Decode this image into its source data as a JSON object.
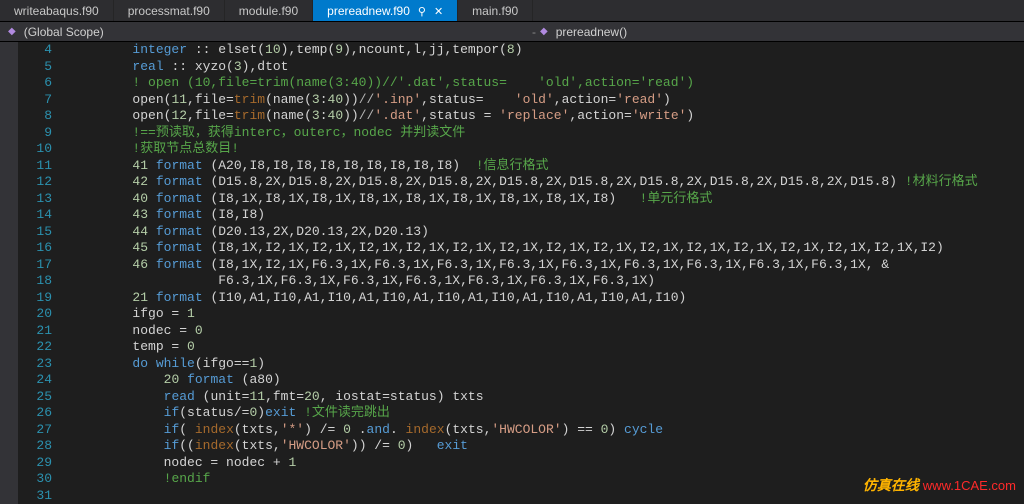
{
  "tabs": [
    {
      "label": "writeabaqus.f90",
      "active": false
    },
    {
      "label": "processmat.f90",
      "active": false
    },
    {
      "label": "module.f90",
      "active": false
    },
    {
      "label": "prereadnew.f90",
      "active": true
    },
    {
      "label": "main.f90",
      "active": false
    }
  ],
  "breadcrumb": {
    "scope": "(Global Scope)",
    "member": "prereadnew()"
  },
  "line_start": 4,
  "code": [
    [
      [
        "kw",
        "integer"
      ],
      [
        "txt",
        " :: elset("
      ],
      [
        "num",
        "10"
      ],
      [
        "txt",
        "),temp("
      ],
      [
        "num",
        "9"
      ],
      [
        "txt",
        "),ncount,l,jj,tempor("
      ],
      [
        "num",
        "8"
      ],
      [
        "txt",
        ")"
      ]
    ],
    [
      [
        "kw",
        "real"
      ],
      [
        "txt",
        " :: xyzo("
      ],
      [
        "num",
        "3"
      ],
      [
        "txt",
        "),dtot"
      ]
    ],
    [
      [
        "cmt",
        "! open (10,file=trim(name(3:40))//'.dat',status=    'old',action='read')"
      ]
    ],
    [
      [
        "txt",
        "open("
      ],
      [
        "num",
        "11"
      ],
      [
        "txt",
        ",file="
      ],
      [
        "fn",
        "trim"
      ],
      [
        "txt",
        "(name("
      ],
      [
        "num",
        "3"
      ],
      [
        "txt",
        ":"
      ],
      [
        "num",
        "40"
      ],
      [
        "txt",
        "))"
      ],
      [
        "op",
        "//"
      ],
      [
        "str",
        "'.inp'"
      ],
      [
        "txt",
        ",status=    "
      ],
      [
        "str",
        "'old'"
      ],
      [
        "txt",
        ",action="
      ],
      [
        "str",
        "'read'"
      ],
      [
        "txt",
        ")"
      ]
    ],
    [
      [
        "txt",
        "open("
      ],
      [
        "num",
        "12"
      ],
      [
        "txt",
        ",file="
      ],
      [
        "fn",
        "trim"
      ],
      [
        "txt",
        "(name("
      ],
      [
        "num",
        "3"
      ],
      [
        "txt",
        ":"
      ],
      [
        "num",
        "40"
      ],
      [
        "txt",
        "))"
      ],
      [
        "op",
        "//"
      ],
      [
        "str",
        "'.dat'"
      ],
      [
        "txt",
        ",status = "
      ],
      [
        "str",
        "'replace'"
      ],
      [
        "txt",
        ",action="
      ],
      [
        "str",
        "'write'"
      ],
      [
        "txt",
        ")"
      ]
    ],
    [
      [
        "cmt",
        "!==预读取，获得interc，outerc，nodec 并判读文件"
      ]
    ],
    [
      [
        "cmt",
        "!获取节点总数目!"
      ]
    ],
    [
      [
        "num",
        "41"
      ],
      [
        "txt",
        " "
      ],
      [
        "kw",
        "format"
      ],
      [
        "txt",
        " (A20,I8,I8,I8,I8,I8,I8,I8,I8,I8)  "
      ],
      [
        "cmt",
        "!信息行格式"
      ]
    ],
    [
      [
        "num",
        "42"
      ],
      [
        "txt",
        " "
      ],
      [
        "kw",
        "format"
      ],
      [
        "txt",
        " (D15.8,2X,D15.8,2X,D15.8,2X,D15.8,2X,D15.8,2X,D15.8,2X,D15.8,2X,D15.8,2X,D15.8,2X,D15.8) "
      ],
      [
        "cmt",
        "!材料行格式"
      ]
    ],
    [
      [
        "num",
        "40"
      ],
      [
        "txt",
        " "
      ],
      [
        "kw",
        "format"
      ],
      [
        "txt",
        " (I8,1X,I8,1X,I8,1X,I8,1X,I8,1X,I8,1X,I8,1X,I8,1X,I8)   "
      ],
      [
        "cmt",
        "!单元行格式"
      ]
    ],
    [
      [
        "num",
        "43"
      ],
      [
        "txt",
        " "
      ],
      [
        "kw",
        "format"
      ],
      [
        "txt",
        " (I8,I8)"
      ]
    ],
    [
      [
        "num",
        "44"
      ],
      [
        "txt",
        " "
      ],
      [
        "kw",
        "format"
      ],
      [
        "txt",
        " (D20.13,2X,D20.13,2X,D20.13)"
      ]
    ],
    [
      [
        "num",
        "45"
      ],
      [
        "txt",
        " "
      ],
      [
        "kw",
        "format"
      ],
      [
        "txt",
        " (I8,1X,I2,1X,I2,1X,I2,1X,I2,1X,I2,1X,I2,1X,I2,1X,I2,1X,I2,1X,I2,1X,I2,1X,I2,1X,I2,1X,I2,1X,I2)"
      ]
    ],
    [
      [
        "num",
        "46"
      ],
      [
        "txt",
        " "
      ],
      [
        "kw",
        "format"
      ],
      [
        "txt",
        " (I8,1X,I2,1X,F6.3,1X,F6.3,1X,F6.3,1X,F6.3,1X,F6.3,1X,F6.3,1X,F6.3,1X,F6.3,1X,F6.3,1X, &"
      ]
    ],
    [
      [
        "txt",
        "           F6.3,1X,F6.3,1X,F6.3,1X,F6.3,1X,F6.3,1X,F6.3,1X,F6.3,1X)"
      ]
    ],
    [
      [
        "num",
        "21"
      ],
      [
        "txt",
        " "
      ],
      [
        "kw",
        "format"
      ],
      [
        "txt",
        " (I10,A1,I10,A1,I10,A1,I10,A1,I10,A1,I10,A1,I10,A1,I10,A1,I10)"
      ]
    ],
    [
      [
        "txt",
        "ifgo = "
      ],
      [
        "num",
        "1"
      ]
    ],
    [
      [
        "txt",
        "nodec = "
      ],
      [
        "num",
        "0"
      ]
    ],
    [
      [
        "txt",
        "temp = "
      ],
      [
        "num",
        "0"
      ]
    ],
    [
      [
        "kw",
        "do while"
      ],
      [
        "txt",
        "(ifgo=="
      ],
      [
        "num",
        "1"
      ],
      [
        "txt",
        ")"
      ]
    ],
    [
      [
        "txt",
        "    "
      ],
      [
        "num",
        "20"
      ],
      [
        "txt",
        " "
      ],
      [
        "kw",
        "format"
      ],
      [
        "txt",
        " (a80)"
      ]
    ],
    [
      [
        "txt",
        "    "
      ],
      [
        "kw",
        "read"
      ],
      [
        "txt",
        " (unit="
      ],
      [
        "num",
        "11"
      ],
      [
        "txt",
        ",fmt="
      ],
      [
        "num",
        "20"
      ],
      [
        "txt",
        ", iostat=status) txts"
      ]
    ],
    [
      [
        "txt",
        "    "
      ],
      [
        "kw",
        "if"
      ],
      [
        "txt",
        "(status/="
      ],
      [
        "num",
        "0"
      ],
      [
        "txt",
        ")"
      ],
      [
        "kw",
        "exit"
      ],
      [
        "txt",
        " "
      ],
      [
        "cmt",
        "!文件读完跳出"
      ]
    ],
    [
      [
        "txt",
        "    "
      ],
      [
        "kw",
        "if"
      ],
      [
        "txt",
        "( "
      ],
      [
        "fn",
        "index"
      ],
      [
        "txt",
        "(txts,"
      ],
      [
        "str",
        "'*'"
      ],
      [
        "txt",
        ") /= "
      ],
      [
        "num",
        "0"
      ],
      [
        "txt",
        " ."
      ],
      [
        "kw",
        "and"
      ],
      [
        "txt",
        ". "
      ],
      [
        "fn",
        "index"
      ],
      [
        "txt",
        "(txts,"
      ],
      [
        "str",
        "'HWCOLOR'"
      ],
      [
        "txt",
        ") == "
      ],
      [
        "num",
        "0"
      ],
      [
        "txt",
        ") "
      ],
      [
        "kw",
        "cycle"
      ]
    ],
    [
      [
        "txt",
        "    "
      ],
      [
        "kw",
        "if"
      ],
      [
        "txt",
        "(("
      ],
      [
        "fn",
        "index"
      ],
      [
        "txt",
        "(txts,"
      ],
      [
        "str",
        "'HWCOLOR'"
      ],
      [
        "txt",
        ")) /= "
      ],
      [
        "num",
        "0"
      ],
      [
        "txt",
        ")   "
      ],
      [
        "kw",
        "exit"
      ]
    ],
    [
      [
        "txt",
        "    nodec = nodec + "
      ],
      [
        "num",
        "1"
      ]
    ],
    [
      [
        "txt",
        "    "
      ],
      [
        "cmt",
        "!endif"
      ]
    ],
    [
      [
        "txt",
        ""
      ]
    ]
  ],
  "watermark": {
    "text1": "仿真在线 ",
    "text2": "www.1CAE.com"
  }
}
